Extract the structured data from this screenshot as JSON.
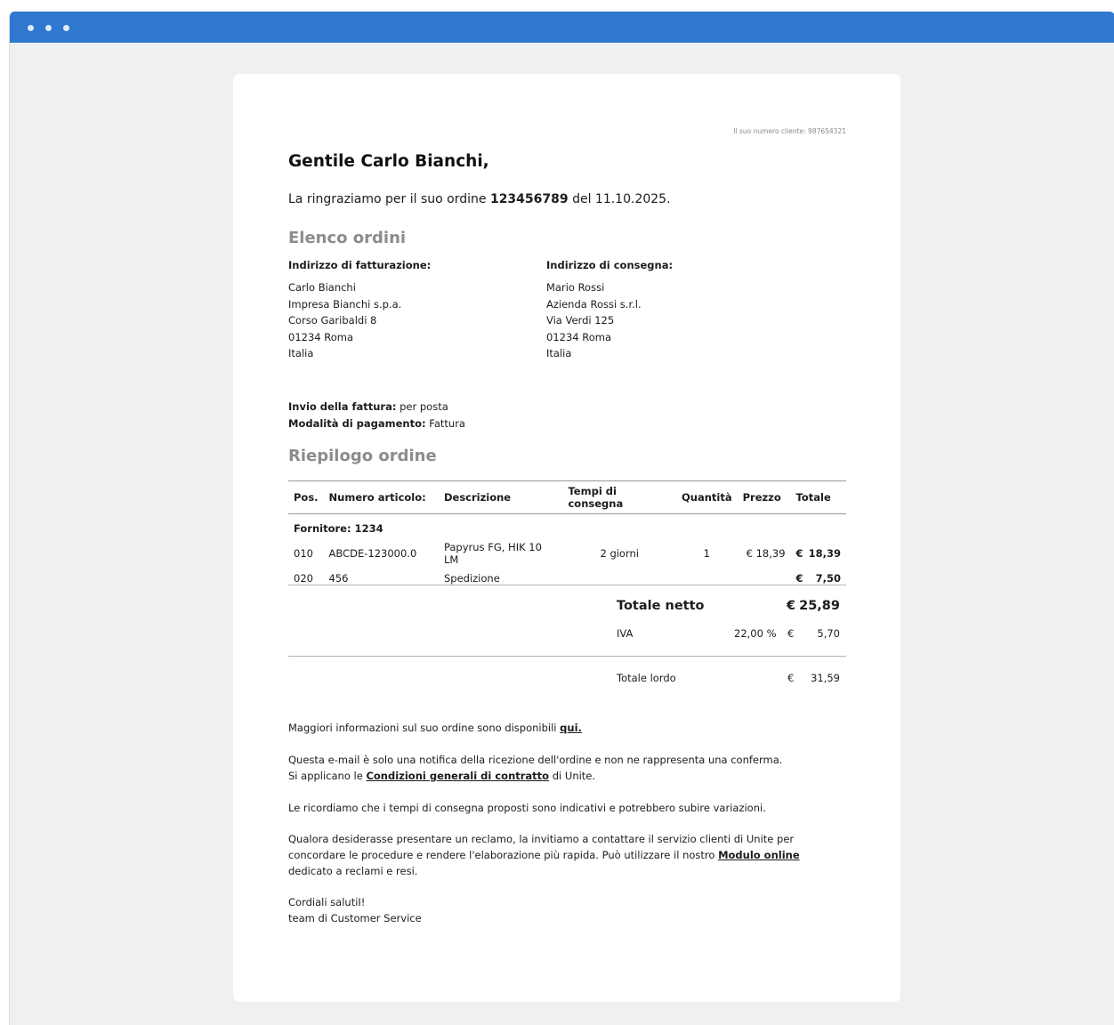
{
  "window": {
    "dots": [
      "dot",
      "dot",
      "dot"
    ]
  },
  "email": {
    "customer_number": "Il suo numero cliente: 987654321",
    "greeting": "Gentile Carlo Bianchi,",
    "thanks_prefix": "La ringraziamo per il suo ordine ",
    "order_number": "123456789",
    "thanks_suffix": " del 11.10.2025.",
    "orders_heading": "Elenco ordini",
    "billing": {
      "label": "Indirizzo di fatturazione:",
      "lines": [
        "Carlo Bianchi",
        "Impresa Bianchi s.p.a.",
        "Corso Garibaldi 8",
        "01234 Roma",
        "Italia"
      ]
    },
    "shipping": {
      "label": "Indirizzo di consegna:",
      "lines": [
        "Mario Rossi",
        "Azienda Rossi s.r.l.",
        "Via Verdi 125",
        "01234 Roma",
        "Italia"
      ]
    },
    "invoice_delivery_label": "Invio della fattura:",
    "invoice_delivery_value": " per posta",
    "payment_label": "Modalità di pagamento:",
    "payment_value": " Fattura",
    "summary_heading": "Riepilogo ordine",
    "table": {
      "headers": [
        "Pos.",
        "Numero articolo:",
        "Descrizione",
        "Tempi di consegna",
        "Quantità",
        "Prezzo",
        "Totale"
      ],
      "supplier": "Fornitore: 1234",
      "rows": [
        {
          "pos": "010",
          "article": "ABCDE-123000.0",
          "desc": "Papyrus FG, HIK 10 LM",
          "delivery": "2 giorni",
          "qty": "1",
          "price": "€ 18,39",
          "cur": "€",
          "total": "18,39"
        },
        {
          "pos": "020",
          "article": "456",
          "desc": "Spedizione",
          "delivery": "",
          "qty": "",
          "price": "",
          "cur": "€",
          "total": "7,50"
        }
      ]
    },
    "totals": {
      "net_label": "Totale netto",
      "net_cur": "€",
      "net_value": "25,89",
      "vat_label": "IVA",
      "vat_rate": "22,00 %",
      "vat_cur": "€",
      "vat_value": "5,70",
      "gross_label": "Totale lordo",
      "gross_cur": "€",
      "gross_value": "31,59"
    },
    "info_prefix": "Maggiori informazioni sul suo ordine sono disponibili ",
    "info_link": "qui.",
    "notice_line1": "Questa e-mail è solo una notifica della ricezione dell'ordine e non ne rappresenta una conferma.",
    "notice_line2_prefix": "Si applicano le ",
    "notice_link": "Condizioni generali di contratto",
    "notice_line2_suffix": " di Unite.",
    "delivery_note": "Le ricordiamo che i tempi di consegna proposti sono indicativi e potrebbero subire variazioni.",
    "complaint_part1": "Qualora desiderasse presentare un reclamo, la invitiamo a contattare il servizio clienti di Unite per concordare le procedure e rendere l'elaborazione più rapida. Può utilizzare il nostro ",
    "complaint_link": "Modulo online",
    "complaint_part2": " dedicato a reclami e resi.",
    "closing": "Cordiali salutiI!",
    "signature": "team di Customer Service"
  }
}
